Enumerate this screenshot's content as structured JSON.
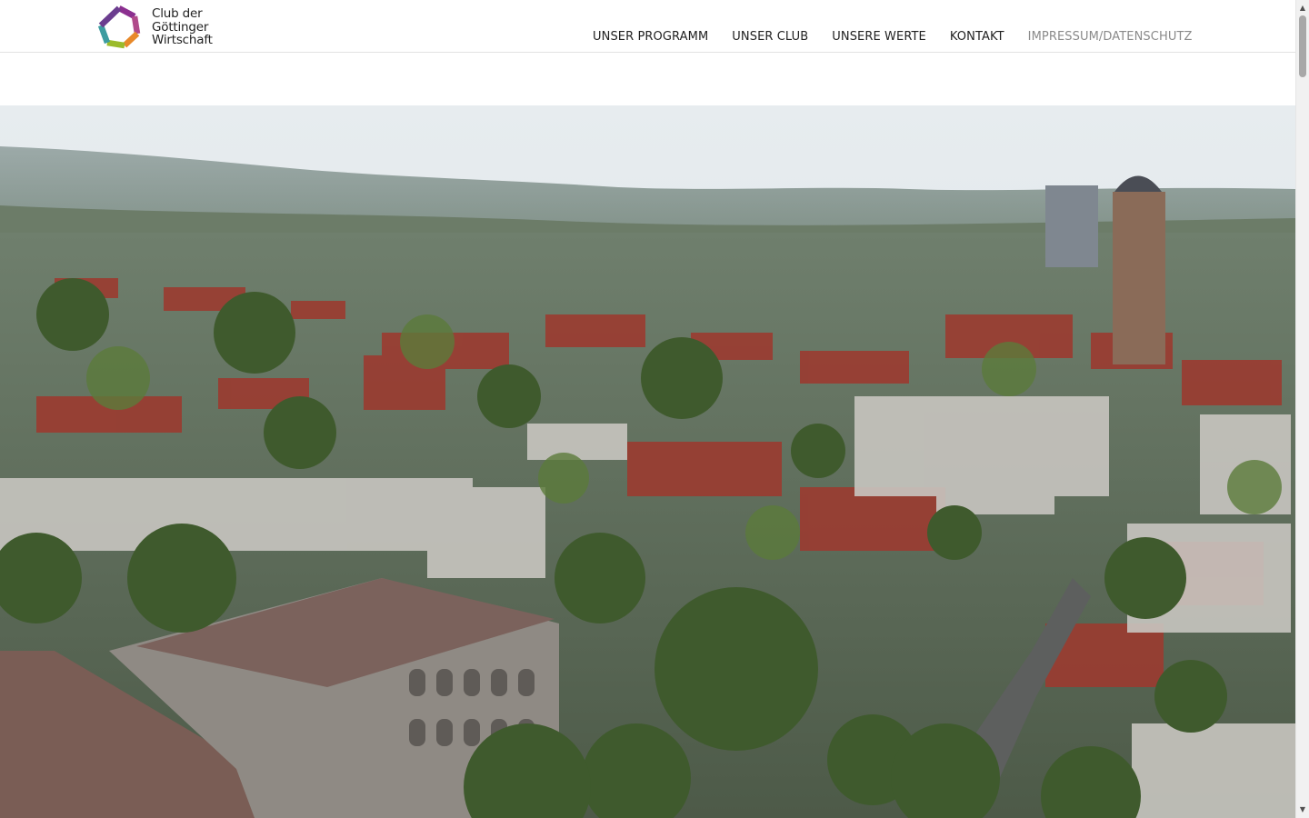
{
  "header": {
    "logo": {
      "line1": "Club der",
      "line2": "Göttinger",
      "line3": "Wirtschaft"
    },
    "nav": [
      {
        "label": "UNSER PROGRAMM"
      },
      {
        "label": "UNSER CLUB"
      },
      {
        "label": "UNSERE WERTE"
      },
      {
        "label": "KONTAKT"
      },
      {
        "label": "IMPRESSUM/DATENSCHUTZ",
        "state": "muted"
      }
    ]
  },
  "hero": {
    "description_icon": "city-panorama-image"
  },
  "scrollbar": {
    "up_icon": "▲",
    "down_icon": "▼"
  },
  "colors": {
    "nav_text": "#222222",
    "nav_muted": "#8a8a8a",
    "logo_purple": "#8b2f8f",
    "logo_orange": "#e8892a",
    "logo_green": "#9bbb2b",
    "logo_teal": "#3c9ca0",
    "roof_red": "#9b3b30"
  }
}
